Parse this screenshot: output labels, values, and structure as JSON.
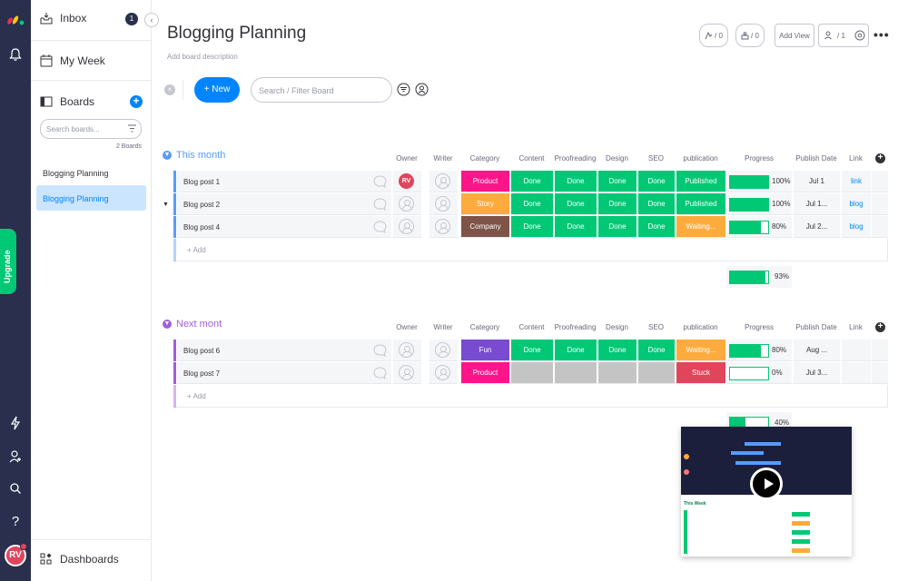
{
  "colors": {
    "rail": "#292f4c",
    "accent": "#0085ff",
    "done": "#00c875",
    "working": "#fdab3d",
    "stuck": "#e2445c",
    "product": "#ff158a",
    "story": "#fdab3d",
    "company": "#7f5347",
    "fun": "#784bd1",
    "group_this_month": "#579bfc",
    "group_next_month": "#a25ddc"
  },
  "rail": {
    "upgrade_label": "Upgrade",
    "avatar_initials": "RV",
    "icons": [
      "monday-logo-icon",
      "bell-icon",
      "lightning-icon",
      "invite-user-icon",
      "search-icon",
      "help-icon"
    ]
  },
  "sidebar": {
    "inbox_label": "Inbox",
    "inbox_count": "1",
    "my_week_label": "My Week",
    "boards_label": "Boards",
    "search_placeholder": "Search boards...",
    "board_count": "2 Boards",
    "boards": [
      "Blogging Planning",
      "Blogging Planning"
    ],
    "dashboards_label": "Dashboards"
  },
  "header": {
    "title": "Blogging Planning",
    "description": "Add board description",
    "activity_count": "/ 0",
    "integrations_count": "/ 0",
    "add_view_label": "Add View",
    "members_count": "/ 1"
  },
  "toolbar": {
    "new_label": "+ New",
    "search_placeholder": "Search / Filter Board"
  },
  "columns": [
    "Owner",
    "Writer",
    "Category",
    "Content",
    "Proofreading",
    "Design",
    "SEO",
    "publication",
    "Progress",
    "Publish Date",
    "Link"
  ],
  "groups": [
    {
      "title": "This month",
      "add_label": "+ Add",
      "summary_progress": 93,
      "summary_label": "93%",
      "rows": [
        {
          "name": "Blog post 1",
          "owner": "RV",
          "category": "Product",
          "content": "Done",
          "proofreading": "Done",
          "design": "Done",
          "seo": "Done",
          "publication": "Published",
          "progress": 100,
          "progress_label": "100%",
          "date": "Jul 1",
          "link": "link"
        },
        {
          "name": "Blog post 2",
          "owner": "",
          "category": "Story",
          "content": "Done",
          "proofreading": "Done",
          "design": "Done",
          "seo": "Done",
          "publication": "Published",
          "progress": 100,
          "progress_label": "100%",
          "date": "Jul 1...",
          "link": "blog"
        },
        {
          "name": "Blog post 4",
          "owner": "",
          "category": "Company",
          "content": "Done",
          "proofreading": "Done",
          "design": "Done",
          "seo": "Done",
          "publication": "Waiting...",
          "progress": 80,
          "progress_label": "80%",
          "date": "Jul 2...",
          "link": "blog"
        }
      ]
    },
    {
      "title": "Next mont",
      "add_label": "+ Add",
      "summary_progress": 40,
      "summary_label": "40%",
      "rows": [
        {
          "name": "Blog post 6",
          "owner": "",
          "category": "Fun",
          "content": "Done",
          "proofreading": "Done",
          "design": "Done",
          "seo": "Done",
          "publication": "Waiting...",
          "progress": 80,
          "progress_label": "80%",
          "date": "Aug ...",
          "link": ""
        },
        {
          "name": "Blog post 7",
          "owner": "",
          "category": "Product",
          "content": "",
          "proofreading": "",
          "design": "",
          "seo": "",
          "publication": "Stuck",
          "progress": 0,
          "progress_label": "0%",
          "date": "Jul 3...",
          "link": ""
        }
      ]
    }
  ],
  "video": {
    "section_label": "This Week"
  }
}
